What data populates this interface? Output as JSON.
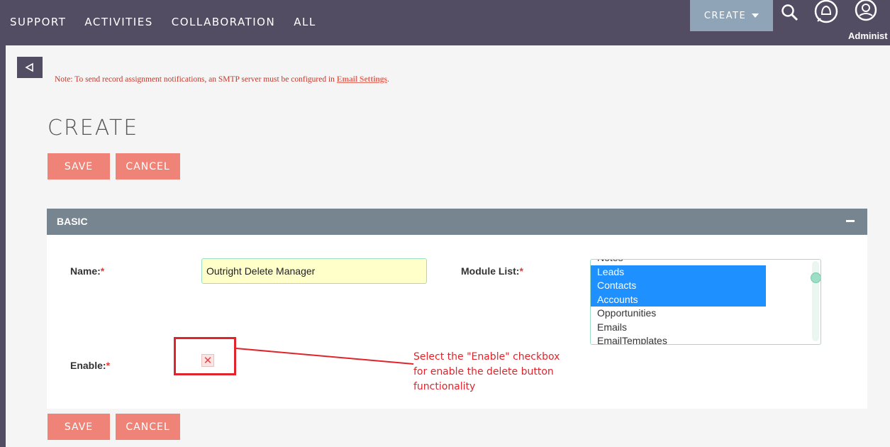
{
  "nav": {
    "menu": [
      "SUPPORT",
      "ACTIVITIES",
      "COLLABORATION",
      "ALL"
    ],
    "create_label": "CREATE",
    "user_label": "Administ"
  },
  "note": {
    "text": "Note: To send record assignment notifications, an SMTP server must be configured in ",
    "link": "Email Settings",
    "suffix": "."
  },
  "page_title": "CREATE",
  "buttons": {
    "save": "SAVE",
    "cancel": "CANCEL"
  },
  "panel": {
    "title": "BASIC"
  },
  "fields": {
    "name_label": "Name:",
    "name_value": "Outright Delete Manager",
    "module_label": "Module List:",
    "module_options": [
      {
        "label": "Notes",
        "selected": false
      },
      {
        "label": "Leads",
        "selected": true
      },
      {
        "label": "Contacts",
        "selected": true
      },
      {
        "label": "Accounts",
        "selected": true
      },
      {
        "label": "Opportunities",
        "selected": false
      },
      {
        "label": "Emails",
        "selected": false
      },
      {
        "label": "EmailTemplates",
        "selected": false
      }
    ],
    "enable_label": "Enable:",
    "enable_checked": true,
    "required_mark": "*"
  },
  "annotation": {
    "text": "Select the \"Enable\" checkbox\nfor enable the delete button\nfunctionality"
  },
  "colors": {
    "nav_bg": "#534d64",
    "accent_button": "#f08377",
    "panel_header": "#778591",
    "selection": "#1e90ff",
    "annotation": "#e0242c"
  }
}
